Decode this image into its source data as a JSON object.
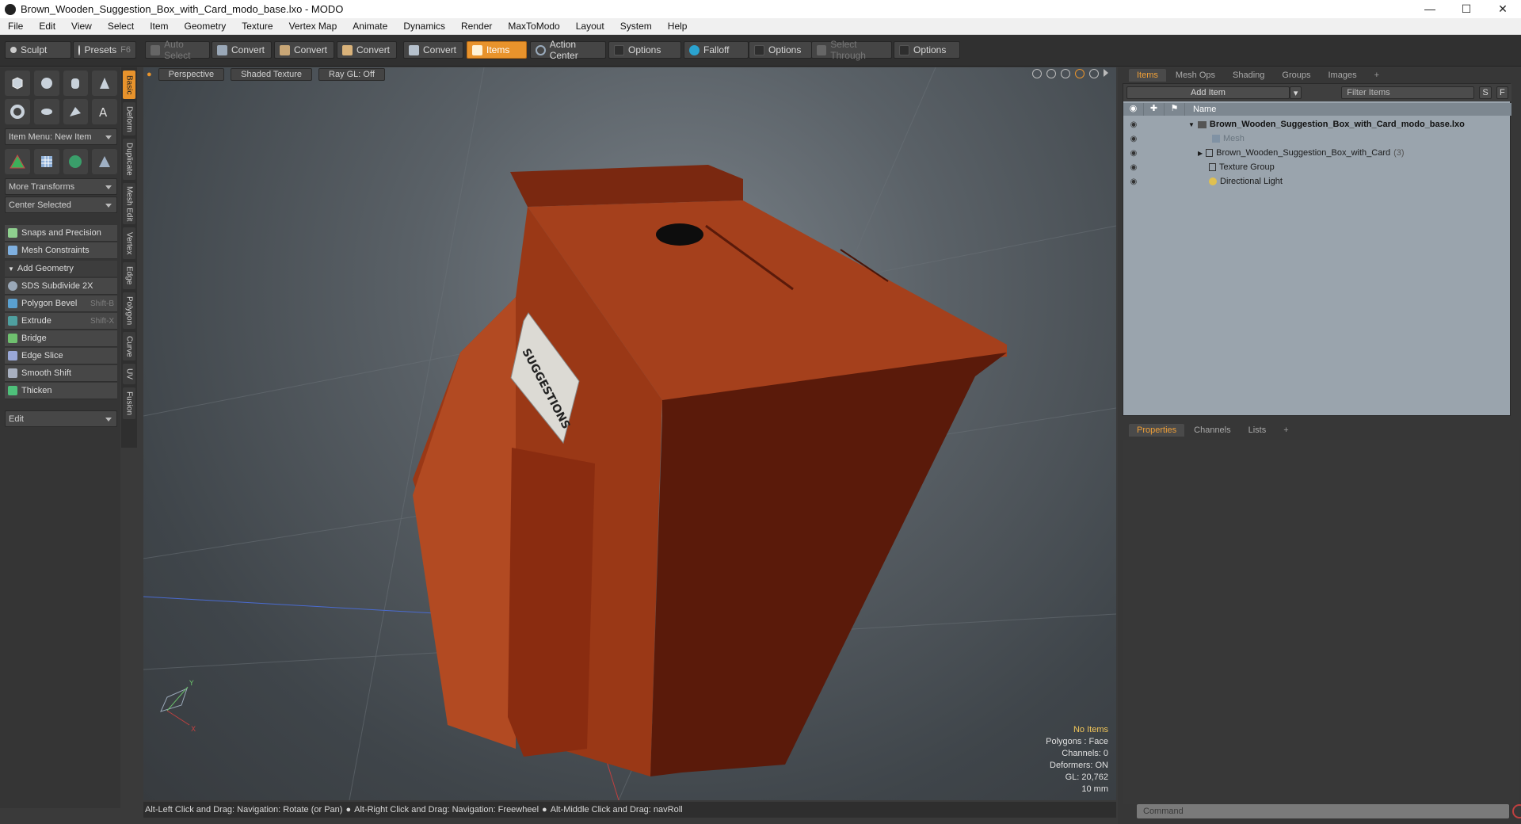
{
  "window": {
    "title": "Brown_Wooden_Suggestion_Box_with_Card_modo_base.lxo - MODO",
    "minimize": "—",
    "maximize": "☐",
    "close": "✕"
  },
  "menu": [
    "File",
    "Edit",
    "View",
    "Select",
    "Item",
    "Geometry",
    "Texture",
    "Vertex Map",
    "Animate",
    "Dynamics",
    "Render",
    "MaxToModo",
    "Layout",
    "System",
    "Help"
  ],
  "toolbar": {
    "sculpt": "Sculpt",
    "presets": "Presets",
    "presets_key": "F6",
    "auto_select": "Auto Select",
    "convert1": "Convert",
    "convert2": "Convert",
    "convert3": "Convert",
    "convert4": "Convert",
    "items": "Items",
    "action_center": "Action Center",
    "options1": "Options",
    "falloff": "Falloff",
    "options2": "Options",
    "select_through": "Select Through",
    "options3": "Options"
  },
  "left": {
    "item_menu": "Item Menu: New Item",
    "more_transforms": "More Transforms",
    "center_selected": "Center Selected",
    "snaps": "Snaps and Precision",
    "mesh_constraints": "Mesh Constraints",
    "add_geometry": "Add Geometry",
    "tools": [
      {
        "label": "SDS Subdivide 2X",
        "key": ""
      },
      {
        "label": "Polygon Bevel",
        "key": "Shift-B"
      },
      {
        "label": "Extrude",
        "key": "Shift-X"
      },
      {
        "label": "Bridge",
        "key": ""
      },
      {
        "label": "Edge Slice",
        "key": ""
      },
      {
        "label": "Smooth Shift",
        "key": ""
      },
      {
        "label": "Thicken",
        "key": ""
      }
    ],
    "edit": "Edit",
    "vtabs": [
      "Basic",
      "Deform",
      "Duplicate",
      "Mesh Edit",
      "Vertex",
      "Edge",
      "Polygon",
      "Curve",
      "UV",
      "Fusion"
    ]
  },
  "viewport": {
    "view": "Perspective",
    "shading": "Shaded Texture",
    "raygl": "Ray GL: Off",
    "card_text": "SUGGESTIONS",
    "info": {
      "items": "No Items",
      "polygons": "Polygons : Face",
      "channels": "Channels: 0",
      "deformers": "Deformers: ON",
      "gl": "GL: 20,762",
      "scale": "10 mm"
    },
    "axis_y": "Y",
    "axis_x": "X"
  },
  "status": {
    "hint1": "Alt-Left Click and Drag: Navigation: Rotate (or Pan)",
    "hint2": "Alt-Right Click and Drag: Navigation: Freewheel",
    "hint3": "Alt-Middle Click and Drag: navRoll"
  },
  "right": {
    "tabs": [
      "Items",
      "Mesh Ops",
      "Shading",
      "Groups",
      "Images"
    ],
    "plus": "+",
    "add_item": "Add Item",
    "filter_placeholder": "Filter Items",
    "s_btn": "S",
    "f_btn": "F",
    "col_name": "Name",
    "tree": [
      {
        "label": "Brown_Wooden_Suggestion_Box_with_Card_modo_base.lxo",
        "count": ""
      },
      {
        "label": "Mesh",
        "count": ""
      },
      {
        "label": "Brown_Wooden_Suggestion_Box_with_Card",
        "count": "(3)"
      },
      {
        "label": "Texture Group",
        "count": ""
      },
      {
        "label": "Directional Light",
        "count": ""
      }
    ],
    "prop_tabs": [
      "Properties",
      "Channels",
      "Lists"
    ],
    "command_placeholder": "Command"
  }
}
